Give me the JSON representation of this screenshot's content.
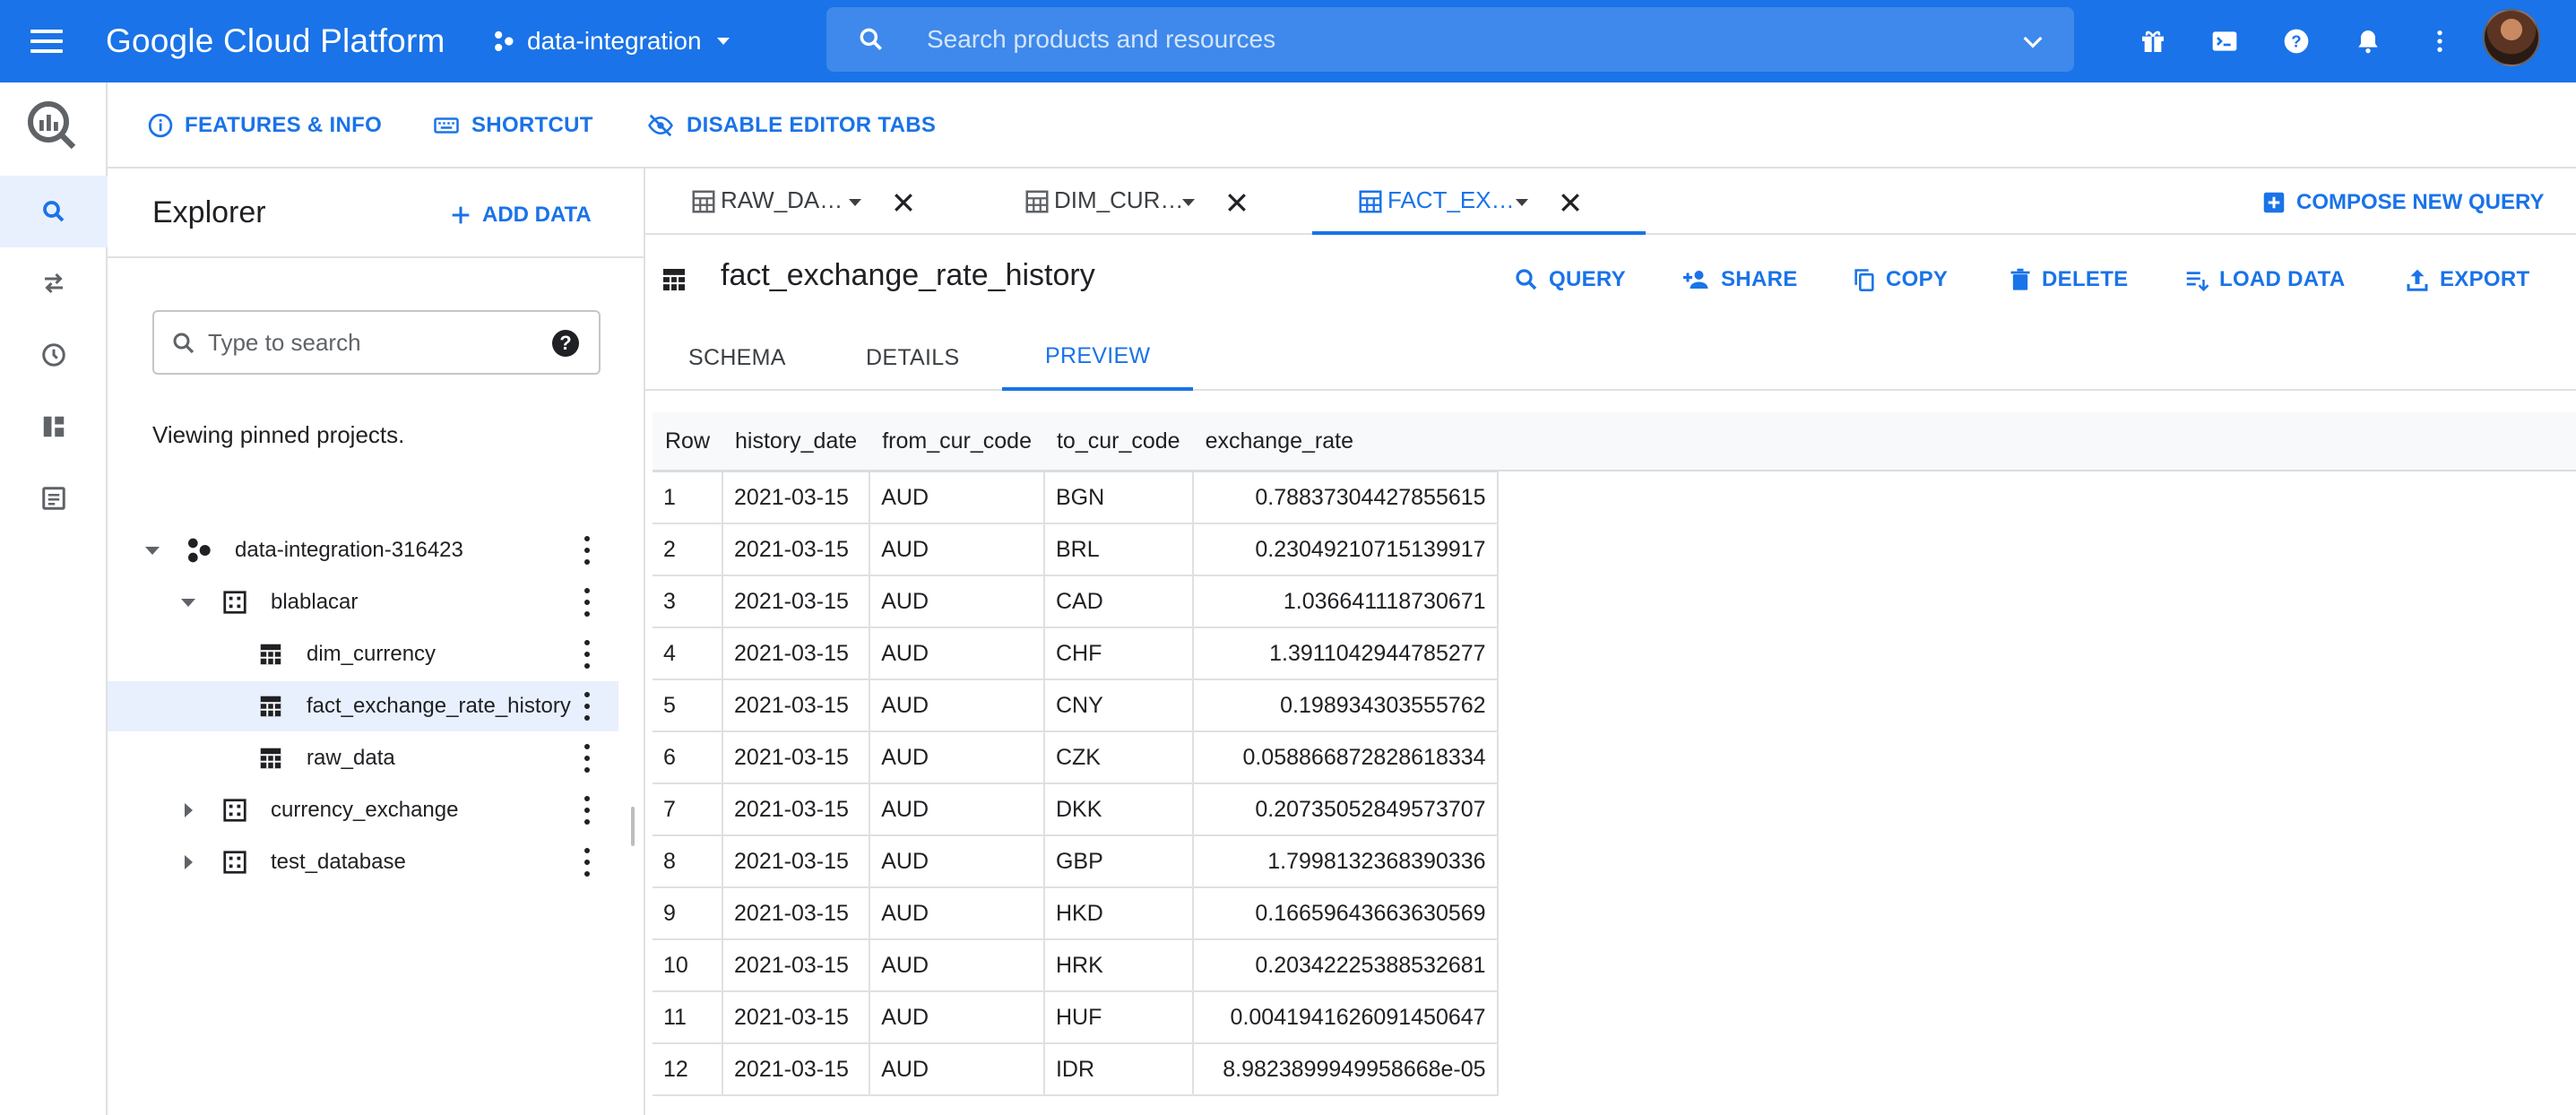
{
  "topbar": {
    "brand": "Google Cloud Platform",
    "project": "data-integration",
    "search_placeholder": "Search products and resources"
  },
  "subbar": {
    "features": "FEATURES & INFO",
    "shortcut": "SHORTCUT",
    "disable_tabs": "DISABLE EDITOR TABS"
  },
  "explorer": {
    "title": "Explorer",
    "add_data": "ADD DATA",
    "search_placeholder": "Type to search",
    "viewing": "Viewing pinned projects.",
    "tree": [
      {
        "label": "data-integration-316423",
        "type": "project",
        "expanded": true
      },
      {
        "label": "blablacar",
        "type": "dataset",
        "expanded": true
      },
      {
        "label": "dim_currency",
        "type": "table"
      },
      {
        "label": "fact_exchange_rate_history",
        "type": "table",
        "selected": true
      },
      {
        "label": "raw_data",
        "type": "table"
      },
      {
        "label": "currency_exchange",
        "type": "dataset",
        "expanded": false
      },
      {
        "label": "test_database",
        "type": "dataset",
        "expanded": false
      }
    ]
  },
  "tabs": [
    {
      "label": "RAW_DA…",
      "active": false
    },
    {
      "label": "DIM_CUR…",
      "active": false
    },
    {
      "label": "FACT_EX…",
      "active": true
    }
  ],
  "compose": "COMPOSE NEW QUERY",
  "table": {
    "title": "fact_exchange_rate_history",
    "actions": {
      "query": "QUERY",
      "share": "SHARE",
      "copy": "COPY",
      "delete": "DELETE",
      "load": "LOAD DATA",
      "export": "EXPORT"
    },
    "subtabs": [
      "SCHEMA",
      "DETAILS",
      "PREVIEW"
    ],
    "active_subtab": "PREVIEW",
    "columns": [
      "Row",
      "history_date",
      "from_cur_code",
      "to_cur_code",
      "exchange_rate"
    ],
    "rows": [
      [
        "1",
        "2021-03-15",
        "AUD",
        "BGN",
        "0.78837304427855615"
      ],
      [
        "2",
        "2021-03-15",
        "AUD",
        "BRL",
        "0.23049210715139917"
      ],
      [
        "3",
        "2021-03-15",
        "AUD",
        "CAD",
        "1.036641118730671"
      ],
      [
        "4",
        "2021-03-15",
        "AUD",
        "CHF",
        "1.3911042944785277"
      ],
      [
        "5",
        "2021-03-15",
        "AUD",
        "CNY",
        "0.198934303555762"
      ],
      [
        "6",
        "2021-03-15",
        "AUD",
        "CZK",
        "0.058866872828618334"
      ],
      [
        "7",
        "2021-03-15",
        "AUD",
        "DKK",
        "0.20735052849573707"
      ],
      [
        "8",
        "2021-03-15",
        "AUD",
        "GBP",
        "1.7998132368390336"
      ],
      [
        "9",
        "2021-03-15",
        "AUD",
        "HKD",
        "0.16659643663630569"
      ],
      [
        "10",
        "2021-03-15",
        "AUD",
        "HRK",
        "0.20342225388532681"
      ],
      [
        "11",
        "2021-03-15",
        "AUD",
        "HUF",
        "0.0041941626091450647"
      ],
      [
        "12",
        "2021-03-15",
        "AUD",
        "IDR",
        "8.9823899949958668e-05"
      ]
    ]
  },
  "colors": {
    "accent": "#1a73e8",
    "selected_bg": "#e8f0fe"
  }
}
